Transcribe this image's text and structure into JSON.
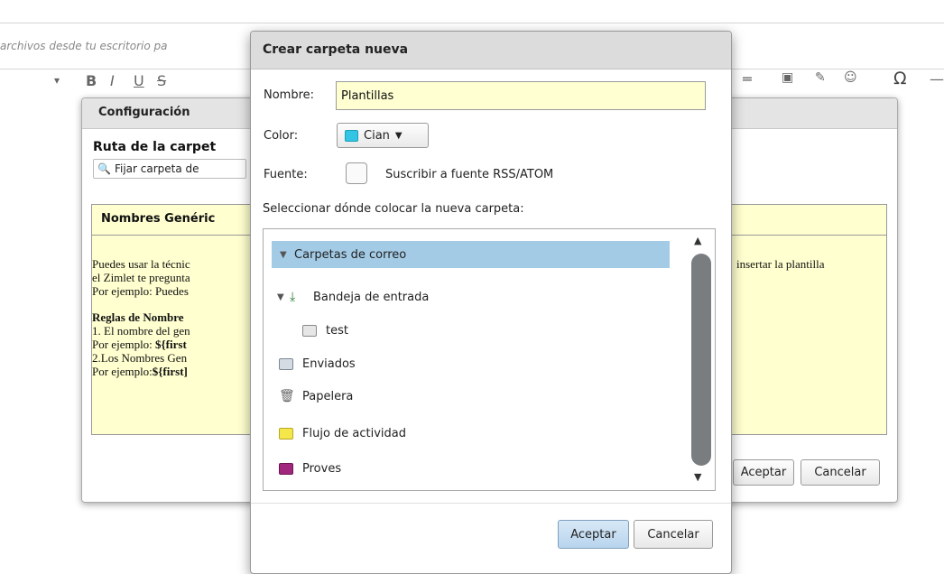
{
  "background": {
    "upload_hint": "archivos desde tu escritorio pa",
    "toolbar": {
      "dropdown_arrow": "▾",
      "bold": "B",
      "italic": "I",
      "underline": "U",
      "strike": "S",
      "omega": "Ω"
    }
  },
  "config_dialog": {
    "title": "Configuración",
    "route_label": "Ruta de la carpet",
    "fix_folder_button": "Fijar carpeta de",
    "generic_names_header": "Nombres Genéric",
    "body_lines": [
      "Puedes usar la técnic",
      "el Zimlet te pregunta",
      "Por ejemplo: Puedes"
    ],
    "right_text": "insertar la plantilla",
    "rules_title": "Reglas de Nombre",
    "rule_1": "1. El nombre del gen",
    "rule_1_example_prefix": "Por ejemplo: ",
    "rule_1_example_code": "${first",
    "rule_2": "2.Los Nombres Gen",
    "rule_2_example_prefix": "Por ejemplo:",
    "rule_2_example_code": "${first]",
    "ok_button": "Aceptar",
    "cancel_button": "Cancelar"
  },
  "new_folder_dialog": {
    "title": "Crear carpeta nueva",
    "name_label": "Nombre:",
    "name_value": "Plantillas",
    "color_label": "Color:",
    "color_value": "Cian",
    "source_label": "Fuente:",
    "subscribe_label": "Suscribir a fuente RSS/ATOM",
    "location_label": "Seleccionar dónde colocar la nueva carpeta:",
    "folders": [
      {
        "label": "Carpetas de correo",
        "icon": "none",
        "expanded": true,
        "selected": true
      },
      {
        "label": "Bandeja de entrada",
        "icon": "inbox-icon",
        "expanded": true
      },
      {
        "label": "test",
        "icon": "folder-icon",
        "color": "#e6e6e6"
      },
      {
        "label": "Enviados",
        "icon": "sent-icon"
      },
      {
        "label": "Papelera",
        "icon": "trash-icon"
      },
      {
        "label": "Flujo de actividad",
        "icon": "folder-icon",
        "color": "#f5e64a"
      },
      {
        "label": "Proves",
        "icon": "folder-icon",
        "color": "#a0267e"
      }
    ],
    "ok_button": "Aceptar",
    "cancel_button": "Cancelar"
  },
  "colors": {
    "cyan_swatch": "#33c5e3",
    "yellow_panel": "#ffffd0",
    "selected_row": "#a4cbe6",
    "input_bg": "#ffffd2"
  }
}
